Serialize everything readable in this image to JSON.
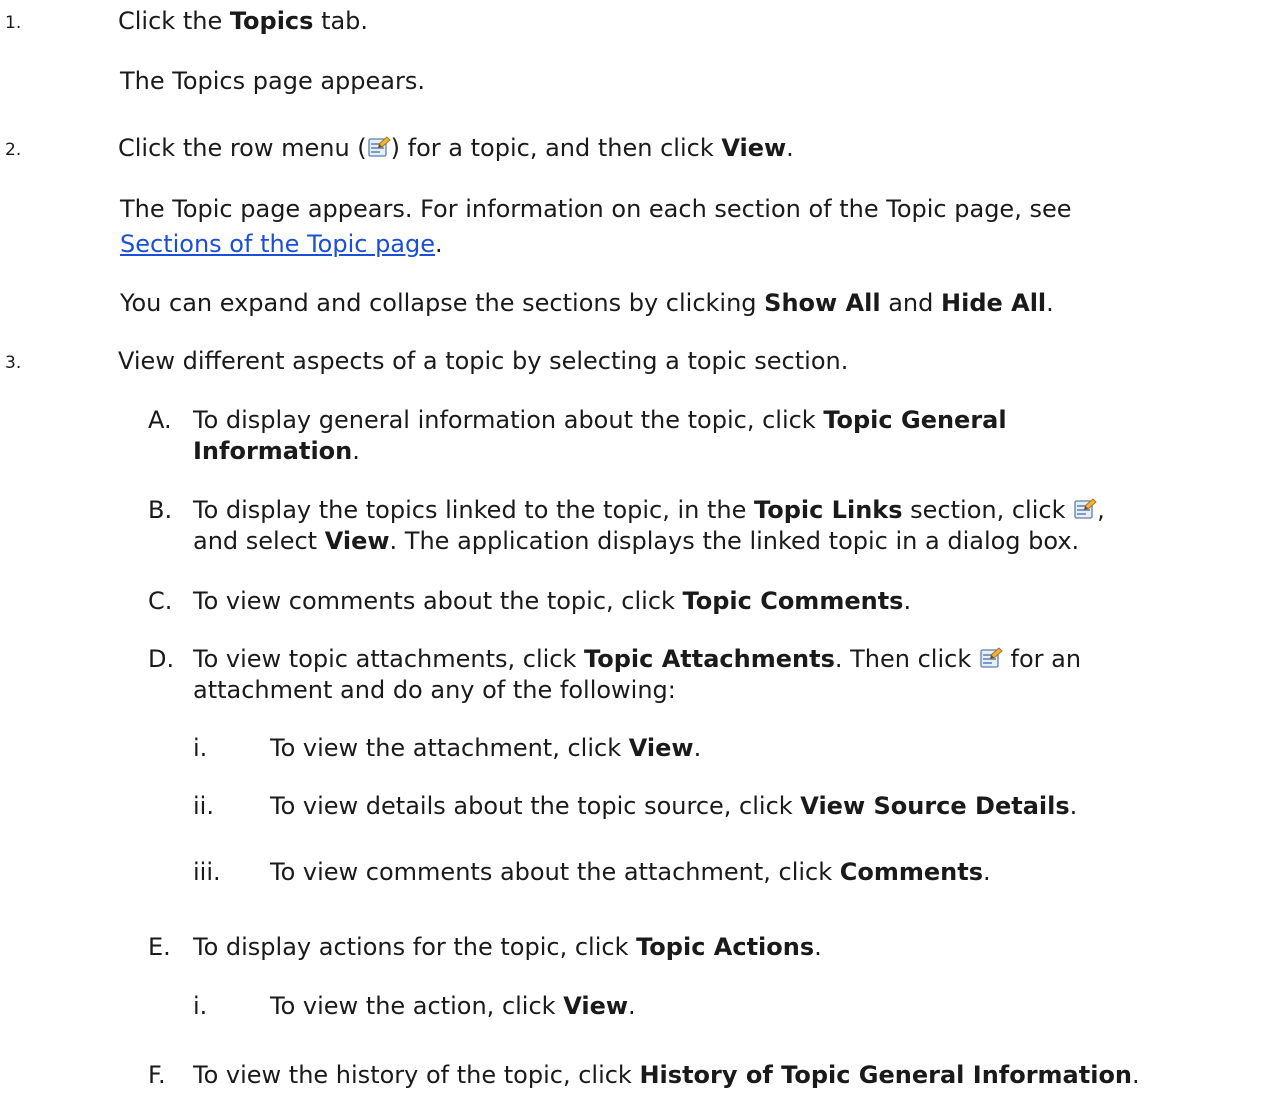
{
  "steps": [
    {
      "number": "1.",
      "pre": "Click the ",
      "bold": "Topics",
      "post": " tab.",
      "result": "The Topics page appears."
    },
    {
      "number": "2.",
      "pre": "Click the row menu (",
      "icon": "row-menu-icon",
      "mid": ") for a topic, and then click ",
      "bold": "View",
      "post": ".",
      "result_line1": "The Topic page appears. For information on each section of the Topic page, see",
      "result_link": "Sections of the Topic page",
      "result_link_post": ".",
      "note_pre": "You can expand and collapse the sections by clicking ",
      "note_bold1": "Show All",
      "note_mid": " and ",
      "note_bold2": "Hide All",
      "note_post": "."
    },
    {
      "number": "3.",
      "text": "View different aspects of a topic by selecting a topic section.",
      "substeps": [
        {
          "letter": "A.",
          "line1_pre": "To display general information about the topic, click ",
          "line1_bold": "Topic General",
          "line2_bold": "Information",
          "line2_post": "."
        },
        {
          "letter": "B.",
          "line1_pre": "To display the topics linked to the topic, in the ",
          "line1_bold": "Topic Links",
          "line1_mid": " section, click ",
          "line1_post": ",",
          "line2_pre": "and select ",
          "line2_bold": "View",
          "line2_post": ". The application displays the linked topic in a dialog box."
        },
        {
          "letter": "C.",
          "pre": "To view comments about the topic, click ",
          "bold": "Topic Comments",
          "post": "."
        },
        {
          "letter": "D.",
          "line1_pre": "To view topic attachments, click ",
          "line1_bold": "Topic Attachments",
          "line1_mid": ". Then click ",
          "line1_post": " for an",
          "line2": "attachment and do any of the following:",
          "items": [
            {
              "roman": "i.",
              "pre": "To view the attachment, click ",
              "bold": "View",
              "post": "."
            },
            {
              "roman": "ii.",
              "pre": "To view details about the topic source, click ",
              "bold": "View Source Details",
              "post": "."
            },
            {
              "roman": "iii.",
              "pre": "To view comments about the attachment, click ",
              "bold": "Comments",
              "post": "."
            }
          ]
        },
        {
          "letter": "E.",
          "pre": "To display actions for the topic, click ",
          "bold": "Topic Actions",
          "post": ".",
          "items": [
            {
              "roman": "i.",
              "pre": "To view the action, click ",
              "bold": "View",
              "post": "."
            }
          ]
        },
        {
          "letter": "F.",
          "pre": "To view the history of the topic, click ",
          "bold": "History of Topic General Information",
          "post": "."
        }
      ]
    }
  ]
}
